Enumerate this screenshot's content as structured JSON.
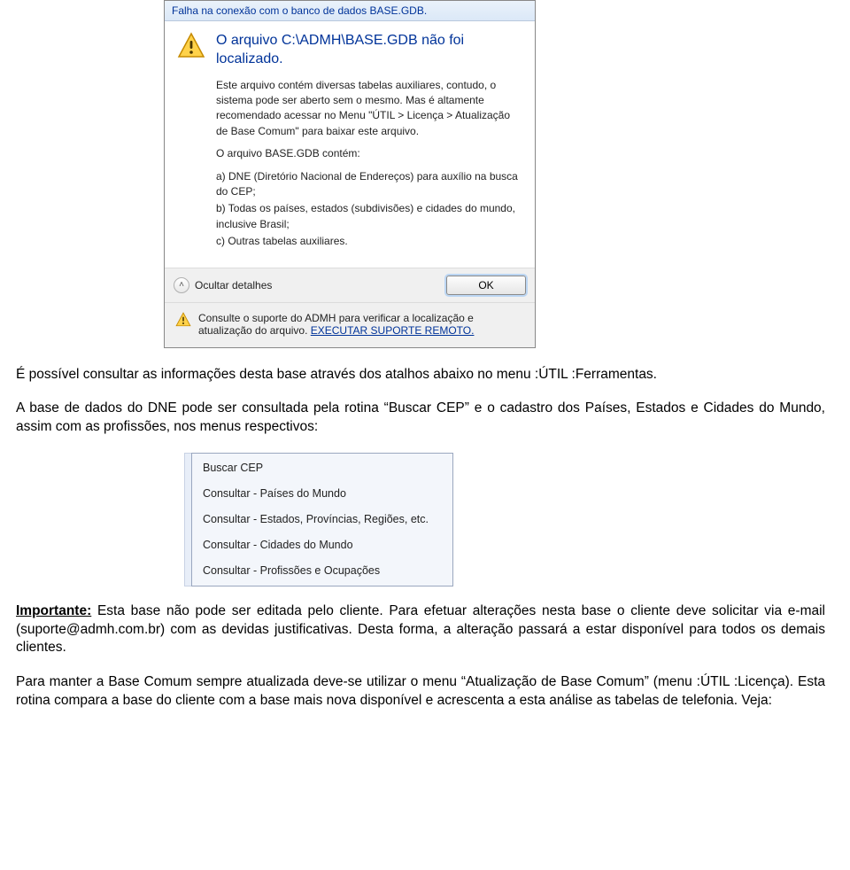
{
  "dialog": {
    "title": "Falha na conexão com o banco de dados BASE.GDB.",
    "main": "O arquivo C:\\ADMH\\BASE.GDB não foi localizado.",
    "p1": "Este arquivo contém diversas tabelas auxiliares, contudo, o sistema pode ser aberto sem o mesmo. Mas é altamente recomendado acessar no Menu \"ÚTIL > Licença > Atualização de Base Comum\" para baixar este arquivo.",
    "p2_head": "O arquivo BASE.GDB contém:",
    "p2_a": "a) DNE (Diretório Nacional de Endereços) para auxílio na busca do CEP;",
    "p2_b": "b) Todas os países, estados (subdivisões) e cidades do mundo, inclusive Brasil;",
    "p2_c": "c) Outras tabelas auxiliares.",
    "toggle": "Ocultar detalhes",
    "ok": "OK",
    "footnote_a": "Consulte o suporte do ADMH para verificar a localização e atualização do arquivo. ",
    "footnote_link": "EXECUTAR SUPORTE REMOTO."
  },
  "doc": {
    "p1": "É possível consultar as informações desta base através dos atalhos abaixo no menu :ÚTIL :Ferramentas.",
    "p2": "A base de dados do DNE pode ser consultada pela rotina “Buscar CEP” e o cadastro dos Países, Estados e Cidades do Mundo, assim com as profissões, nos menus respectivos:",
    "p3_strong": "Importante:",
    "p3_rest": " Esta base não pode ser editada pelo cliente. Para efetuar alterações nesta base o cliente deve solicitar via e-mail (suporte@admh.com.br) com as devidas justificativas. Desta forma, a alteração passará a estar disponível para todos os demais clientes.",
    "p4": "Para manter a Base Comum sempre atualizada deve-se utilizar o menu “Atualização de Base Comum” (menu :ÚTIL :Licença). Esta rotina compara a base do cliente com a base mais nova disponível e acrescenta a esta análise as tabelas de telefonia. Veja:"
  },
  "menu": {
    "items": [
      "Buscar CEP",
      "Consultar - Países do Mundo",
      "Consultar - Estados, Províncias, Regiões, etc.",
      "Consultar - Cidades do Mundo",
      "Consultar - Profissões e Ocupações"
    ]
  }
}
